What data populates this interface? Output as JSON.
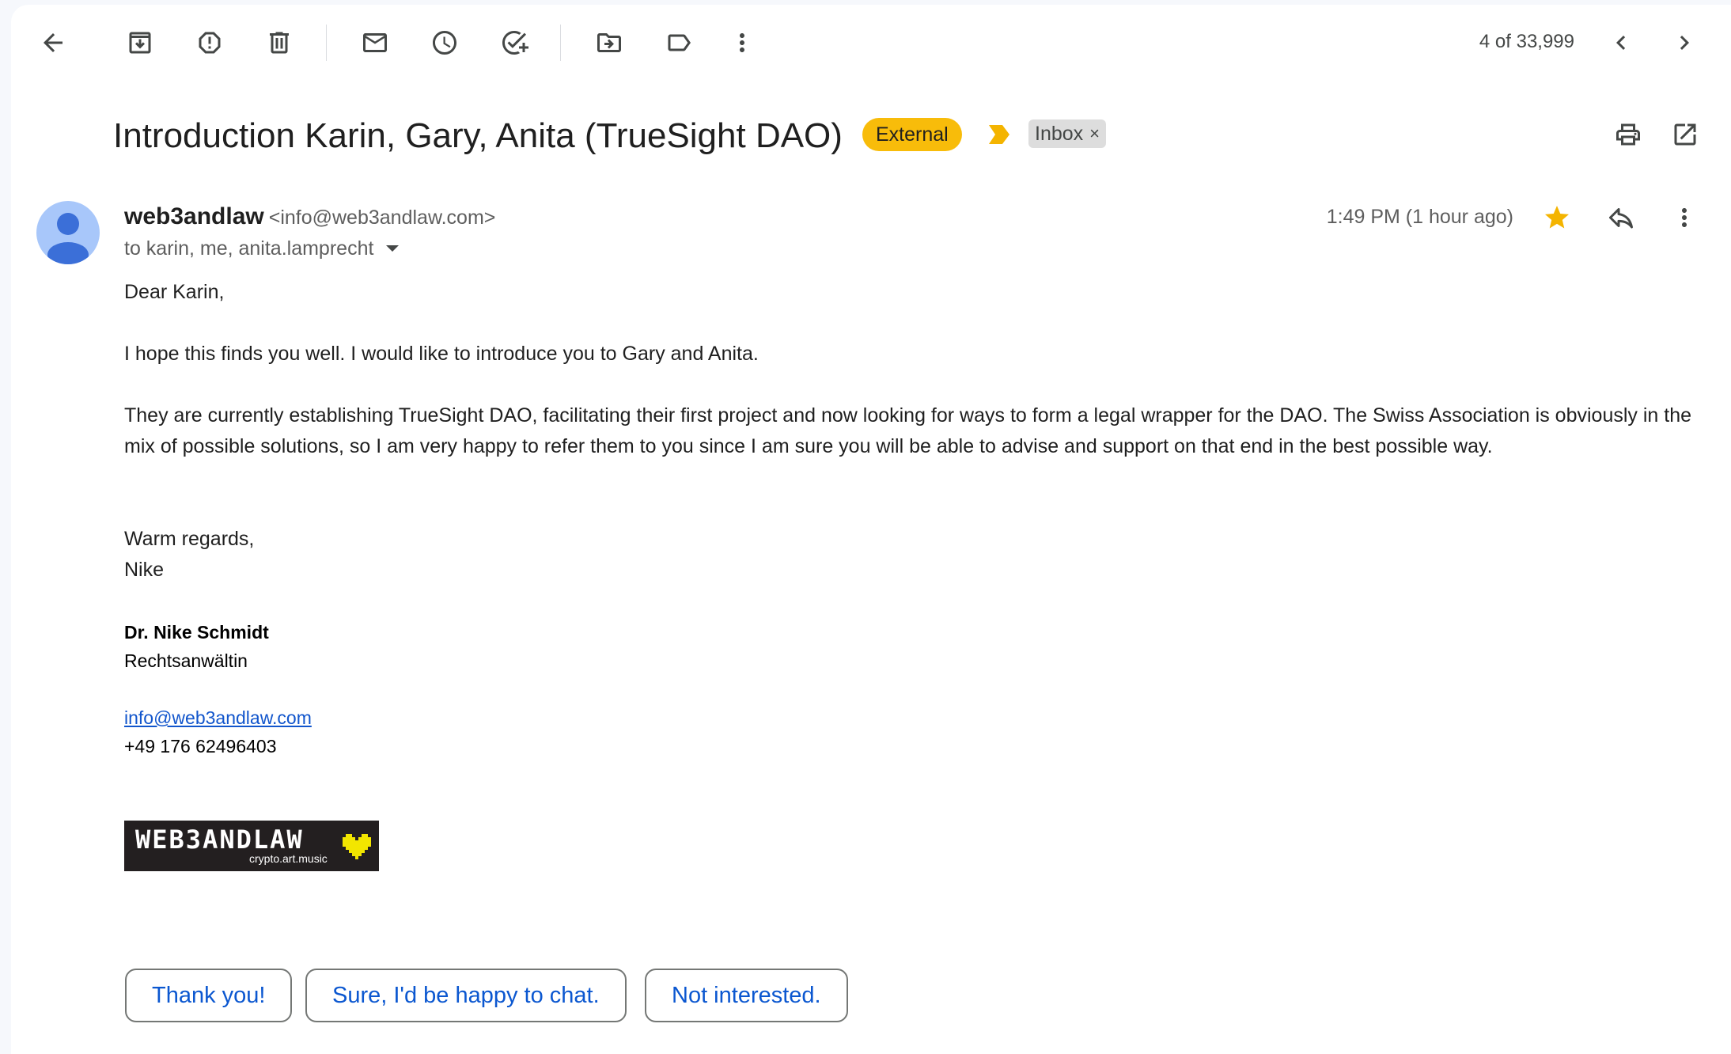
{
  "toolbar": {
    "back_icon": "arrow-left-icon",
    "archive_icon": "archive-icon",
    "report_spam_icon": "report-spam-icon",
    "delete_icon": "trash-icon",
    "mark_unread_icon": "envelope-icon",
    "snooze_icon": "clock-icon",
    "add_task_icon": "add-task-icon",
    "move_to_icon": "move-to-folder-icon",
    "labels_icon": "label-icon",
    "more_icon": "more-vertical-icon",
    "pagination": "4 of 33,999",
    "newer_icon": "chevron-left-icon",
    "older_icon": "chevron-right-icon"
  },
  "header": {
    "subject": "Introduction Karin, Gary, Anita (TrueSight DAO)",
    "external_label": "External",
    "inbox_label": "Inbox",
    "remove_label_glyph": "×",
    "print_icon": "print-icon",
    "open_new_window_icon": "open-in-new-icon"
  },
  "message": {
    "sender_name": "web3andlaw",
    "sender_email": "<info@web3andlaw.com>",
    "recipients": "to karin, me, anita.lamprecht",
    "time": "1:49 PM (1 hour ago)",
    "starred": true,
    "body": {
      "greeting": "Dear Karin,",
      "para1": "I hope this finds you well. I would like to introduce you to Gary and Anita.",
      "para2": "They are currently establishing TrueSight DAO, facilitating their first project and now looking for ways to form a legal wrapper for the DAO. The Swiss Association is obviously in the mix of possible solutions, so I am very happy to refer them to you since I am sure you will be able to advise and support on that end in the best possible way.",
      "closing": "Warm regards,",
      "signoff": "Nike"
    },
    "signature": {
      "name": "Dr. Nike Schmidt",
      "title": "Rechtsanwältin",
      "email": "info@web3andlaw.com",
      "phone": "+49 176 62496403",
      "logo_word": "WEB3ANDLAW",
      "logo_tagline": "crypto.art.music"
    }
  },
  "smart_replies": [
    "Thank you!",
    "Sure, I'd be happy to chat.",
    "Not interested."
  ],
  "colors": {
    "external_chip": "#f8bc0a",
    "star": "#f4b400",
    "link": "#1155cc",
    "reply_text": "#0b57d0",
    "logo_heart": "#f2e600"
  }
}
